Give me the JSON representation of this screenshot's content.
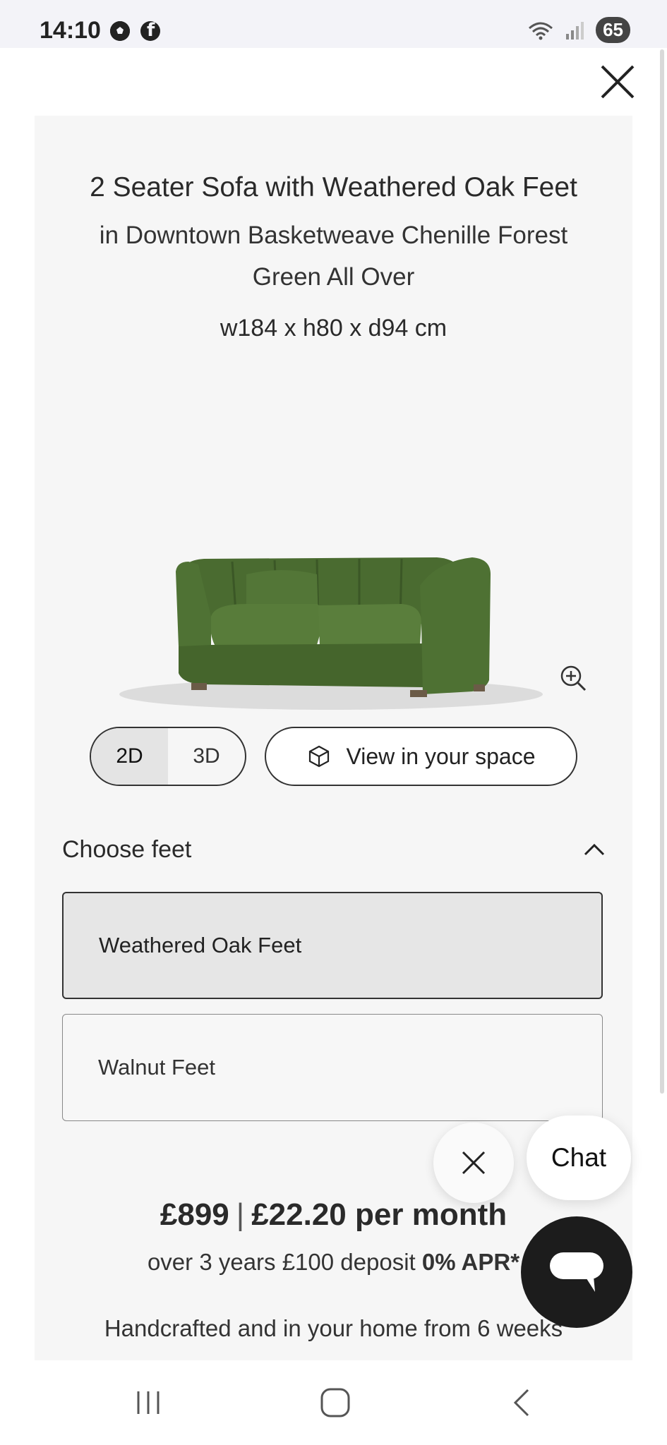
{
  "status_bar": {
    "time": "14:10",
    "battery": "65",
    "icons": [
      "football-icon",
      "facebook-icon",
      "wifi-icon",
      "signal-icon"
    ]
  },
  "product": {
    "title": "2 Seater Sofa with Weathered Oak Feet",
    "subtitle": "in Downtown Basketweave Chenille Forest Green All Over",
    "dimensions": "w184 x h80 x d94 cm",
    "image_alt": "Green chenille 2 seater sofa",
    "fabric_color": "#4a6b30"
  },
  "view_toggle": {
    "options": [
      "2D",
      "3D"
    ],
    "selected": "2D"
  },
  "ar_button": {
    "label": "View in your space"
  },
  "feet": {
    "heading": "Choose feet",
    "expanded": true,
    "options": [
      {
        "label": "Weathered Oak Feet",
        "selected": true
      },
      {
        "label": "Walnut Feet",
        "selected": false
      }
    ]
  },
  "pricing": {
    "price": "£899",
    "monthly": "£22.20 per month",
    "finance_text": "over 3 years £100 deposit ",
    "apr": "0% APR*",
    "delivery": "Handcrafted and in your home from 6 weeks"
  },
  "chat": {
    "label": "Chat"
  },
  "colors": {
    "panel_bg": "#f6f6f6",
    "selected_option_bg": "#e6e6e6",
    "chat_launcher": "#1c1c1c"
  }
}
